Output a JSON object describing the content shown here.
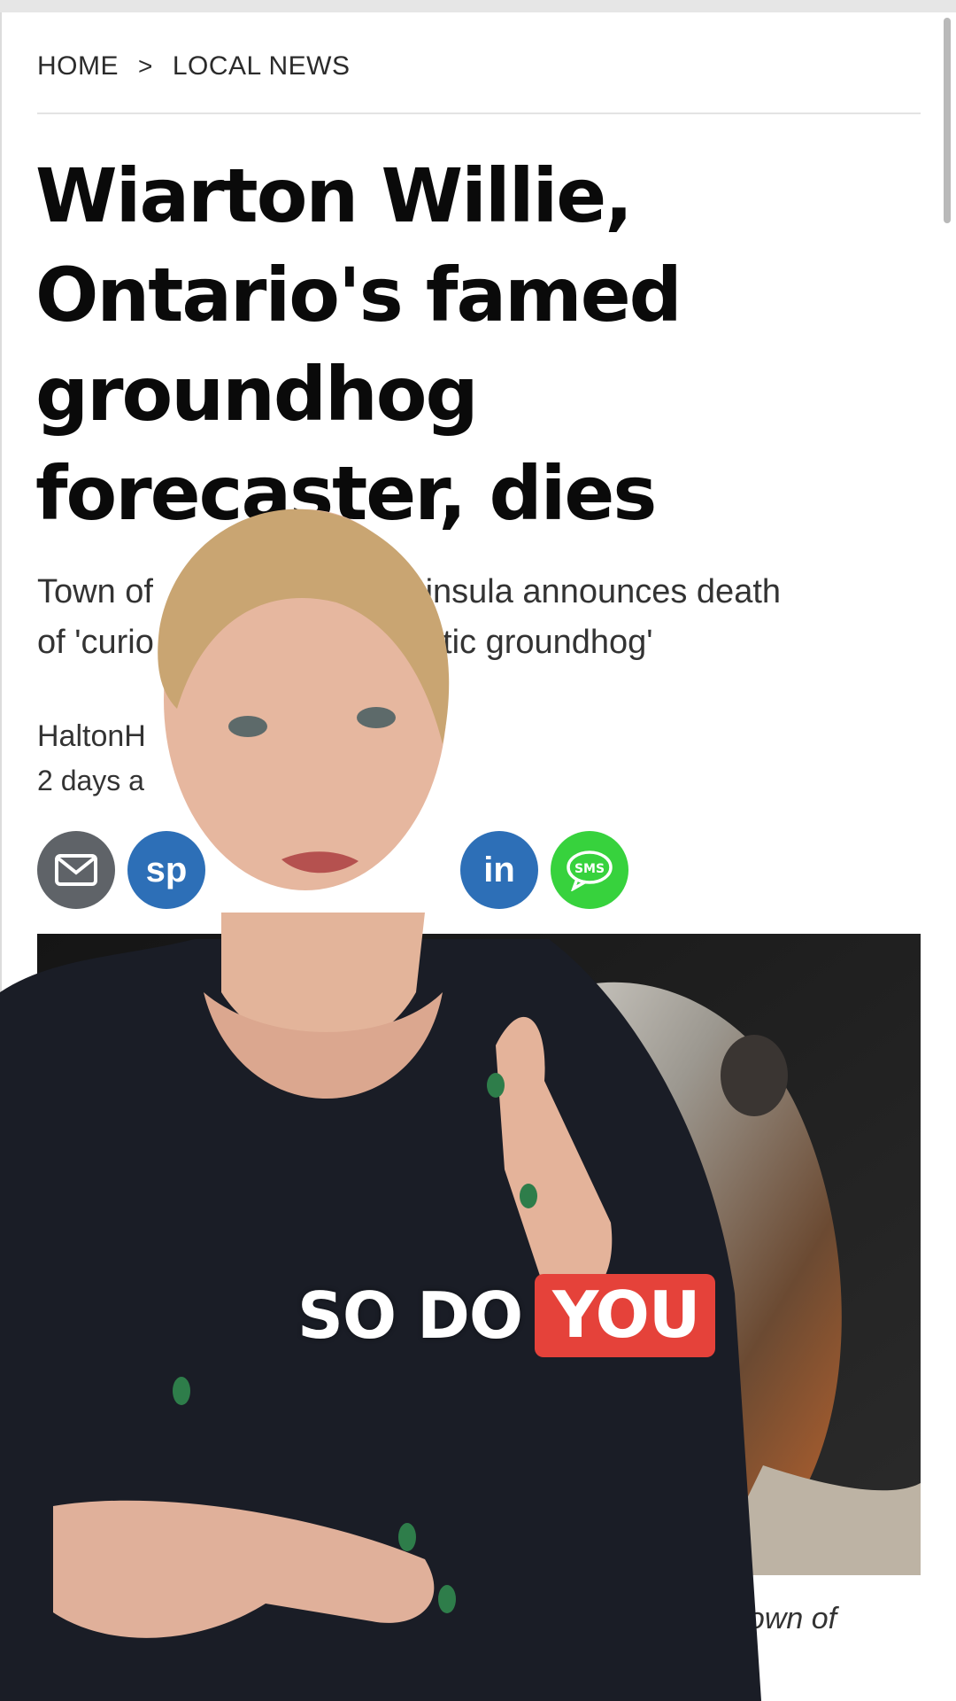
{
  "breadcrumb": {
    "home": "HOME",
    "separator": ">",
    "section": "LOCAL NEWS"
  },
  "article": {
    "headline": "Wiarton Willie, Ontario's famed groundhog forecaster, dies",
    "subhead_line1_a": "Town of",
    "subhead_line1_b": "Peninsula announces death",
    "subhead_line2_a": "of 'curio",
    "subhead_line2_b": "atic groundhog'",
    "byline": "HaltonH",
    "dateline": "2 days a",
    "caption": "he Town of"
  },
  "share": {
    "sms_label": "SMS",
    "social_partial_a": "sp",
    "social_partial_b": "in"
  },
  "overlay": {
    "caption_plain": "SO DO",
    "caption_highlight": "YOU",
    "highlight_color": "#e5423a"
  },
  "icons": [
    "email-icon",
    "sms-icon"
  ]
}
